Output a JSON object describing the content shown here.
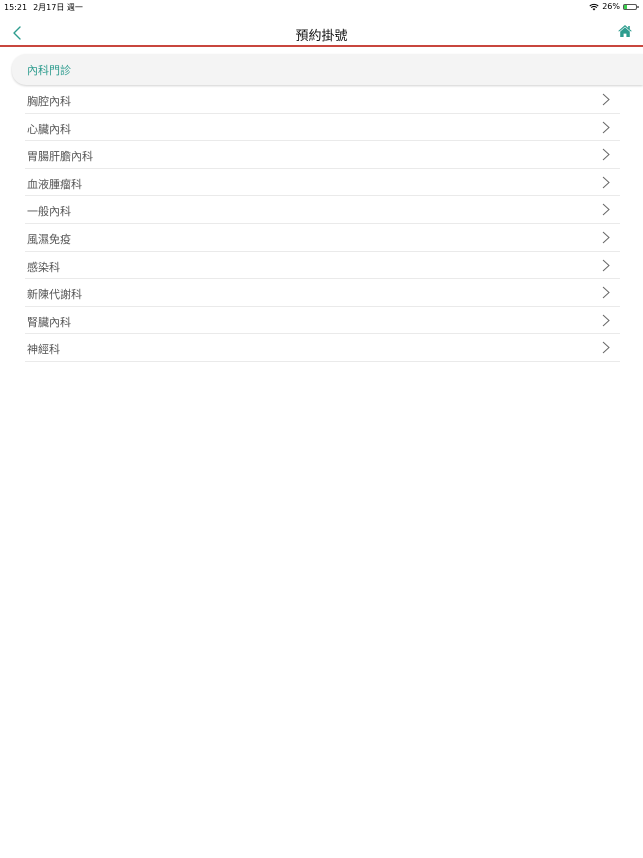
{
  "status_bar": {
    "time": "15:21",
    "date": "2月17日 週一",
    "battery": "26%",
    "battery_level": 0.26
  },
  "nav": {
    "title": "預約掛號",
    "accent_color": "#c8463d",
    "icon_color": "#2d9c8e",
    "back_icon": "chevron-left-icon",
    "home_icon": "home-icon"
  },
  "section": {
    "title": "內科門診"
  },
  "items": [
    {
      "label": "胸腔內科"
    },
    {
      "label": "心臟內科"
    },
    {
      "label": "胃腸肝膽內科"
    },
    {
      "label": "血液腫瘤科"
    },
    {
      "label": "一般內科"
    },
    {
      "label": "風濕免疫"
    },
    {
      "label": "感染科"
    },
    {
      "label": "新陳代謝科"
    },
    {
      "label": "腎臟內科"
    },
    {
      "label": "神經科"
    }
  ]
}
